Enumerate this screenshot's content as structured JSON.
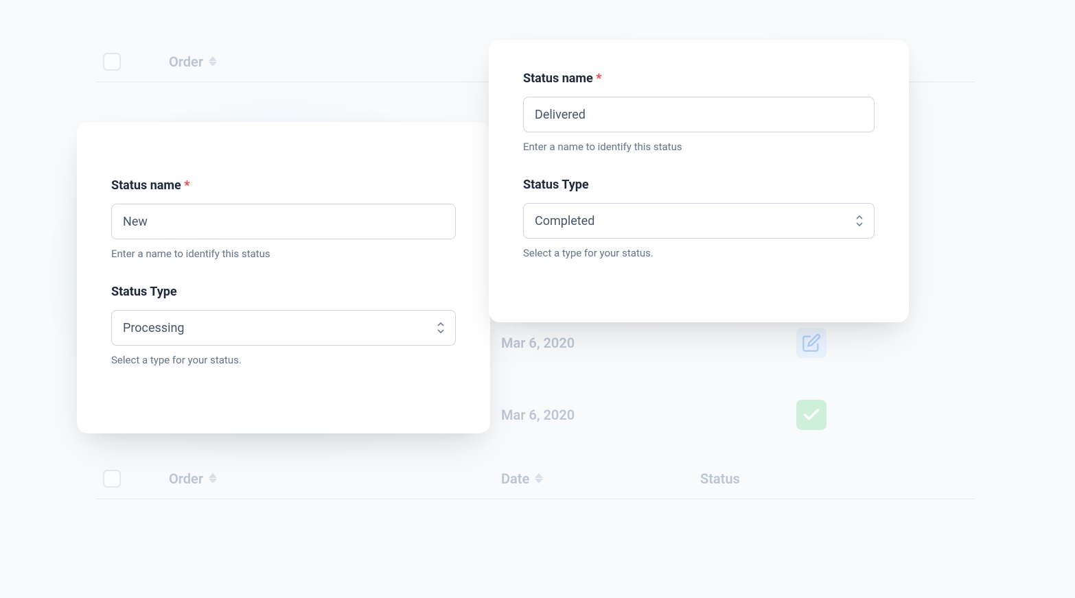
{
  "bg": {
    "columns": {
      "order": "Order",
      "date": "Date",
      "status": "Status"
    },
    "rows": [
      {
        "date": "Mar 6, 2020"
      },
      {
        "date": "Mar 6, 2020"
      }
    ]
  },
  "form1": {
    "name_label": "Status name",
    "name_value": "New",
    "name_hint": "Enter a name to identify this status",
    "type_label": "Status Type",
    "type_value": "Processing",
    "type_hint": "Select a type for your status.",
    "required": "*"
  },
  "form2": {
    "name_label": "Status name",
    "name_value": "Delivered",
    "name_hint": "Enter a name to identify this status",
    "type_label": "Status Type",
    "type_value": "Completed",
    "type_hint": "Select a type for your status.",
    "required": "*"
  }
}
